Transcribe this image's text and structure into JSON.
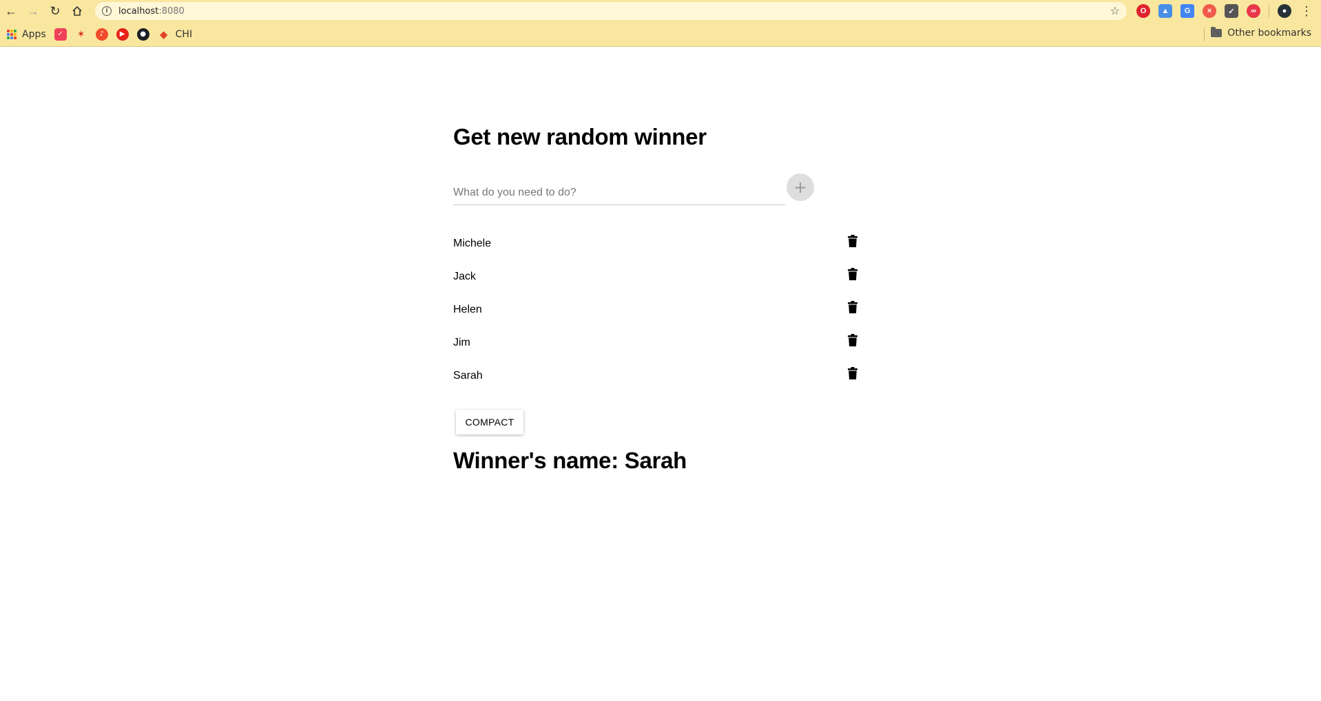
{
  "browser": {
    "url_host": "localhost",
    "url_port": ":8080",
    "bookmarks": {
      "apps_label": "Apps",
      "chi_label": "CHI",
      "other_label": "Other bookmarks"
    },
    "extensions": [
      {
        "name": "opera-icon",
        "color": "#e0222c"
      },
      {
        "name": "drive-off-icon",
        "color": "#4a8fe6"
      },
      {
        "name": "translate-icon",
        "color": "#4285f4"
      },
      {
        "name": "blocker-icon",
        "color": "#f15a4a"
      },
      {
        "name": "pocket-icon",
        "color": "#555555"
      },
      {
        "name": "infinity-icon",
        "color": "#e8364a"
      }
    ]
  },
  "page": {
    "title": "Get new random winner",
    "input": {
      "placeholder": "What do you need to do?",
      "add_symbol": "+"
    },
    "items": [
      {
        "name": "Michele"
      },
      {
        "name": "Jack"
      },
      {
        "name": "Helen"
      },
      {
        "name": "Jim"
      },
      {
        "name": "Sarah"
      }
    ],
    "compact_label": "COMPACT",
    "winner_text": "Winner's name: Sarah"
  }
}
